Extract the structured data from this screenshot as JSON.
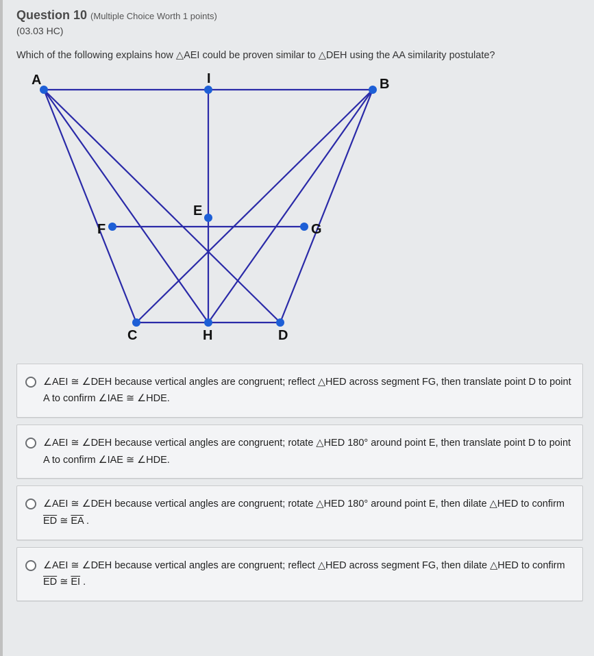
{
  "header": {
    "label": "Question 10",
    "worth": "(Multiple Choice Worth 1 points)",
    "code": "(03.03 HC)"
  },
  "prompt": "Which of the following explains how △AEI could be proven similar to △DEH using the AA similarity postulate?",
  "diagram": {
    "labels": {
      "A": "A",
      "B": "B",
      "C": "C",
      "D": "D",
      "E": "E",
      "F": "F",
      "G": "G",
      "H": "H",
      "I": "I"
    }
  },
  "options": {
    "o1": {
      "p1": "∠AEI ≅ ∠DEH because vertical angles are congruent; reflect △HED across segment FG, then translate point D to point A to confirm ∠IAE ≅ ∠HDE."
    },
    "o2": {
      "p1": "∠AEI ≅ ∠DEH because vertical angles are congruent; rotate △HED 180° around point E, then translate point D to point A to confirm ∠IAE ≅ ∠HDE."
    },
    "o3": {
      "p1_a": "∠AEI ≅ ∠DEH because vertical angles are congruent; rotate △HED 180° around point E, then dilate △HED to confirm ",
      "seg1": "ED",
      "mid": " ≅ ",
      "seg2": "EA",
      "end": "."
    },
    "o4": {
      "p1_a": "∠AEI ≅ ∠DEH because vertical angles are congruent; reflect △HED across segment FG, then dilate △HED to confirm ",
      "seg1": "ED",
      "mid": " ≅ ",
      "seg2": "EI",
      "end": "."
    }
  }
}
